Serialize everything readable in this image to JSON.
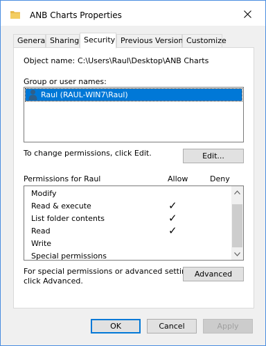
{
  "window": {
    "title": "ANB Charts Properties"
  },
  "tabs": [
    {
      "label": "General"
    },
    {
      "label": "Sharing"
    },
    {
      "label": "Security"
    },
    {
      "label": "Previous Versions"
    },
    {
      "label": "Customize"
    }
  ],
  "active_tab": "Security",
  "object": {
    "label": "Object name:",
    "value": "C:\\Users\\Raul\\Desktop\\ANB Charts"
  },
  "groups": {
    "label": "Group or user names:",
    "items": [
      {
        "label": "Raul (RAUL-WIN7\\Raul)",
        "selected": true
      }
    ]
  },
  "change_perm_text": "To change permissions, click Edit.",
  "edit_button": "Edit...",
  "permissions": {
    "header": "Permissions for Raul",
    "allow_label": "Allow",
    "deny_label": "Deny",
    "rows": [
      {
        "name": "Modify",
        "allow": false,
        "deny": false
      },
      {
        "name": "Read & execute",
        "allow": true,
        "deny": false
      },
      {
        "name": "List folder contents",
        "allow": true,
        "deny": false
      },
      {
        "name": "Read",
        "allow": true,
        "deny": false
      },
      {
        "name": "Write",
        "allow": false,
        "deny": false
      },
      {
        "name": "Special permissions",
        "allow": false,
        "deny": false
      }
    ],
    "check_glyph": "✓"
  },
  "advanced_text_1": "For special permissions or advanced settings,",
  "advanced_text_2": "click Advanced.",
  "advanced_button": "Advanced",
  "buttons": {
    "ok": "OK",
    "cancel": "Cancel",
    "apply": "Apply"
  },
  "colors": {
    "selection": "#0078d7",
    "desktop": "#0a5fd6",
    "folder": "#e8b94a"
  }
}
